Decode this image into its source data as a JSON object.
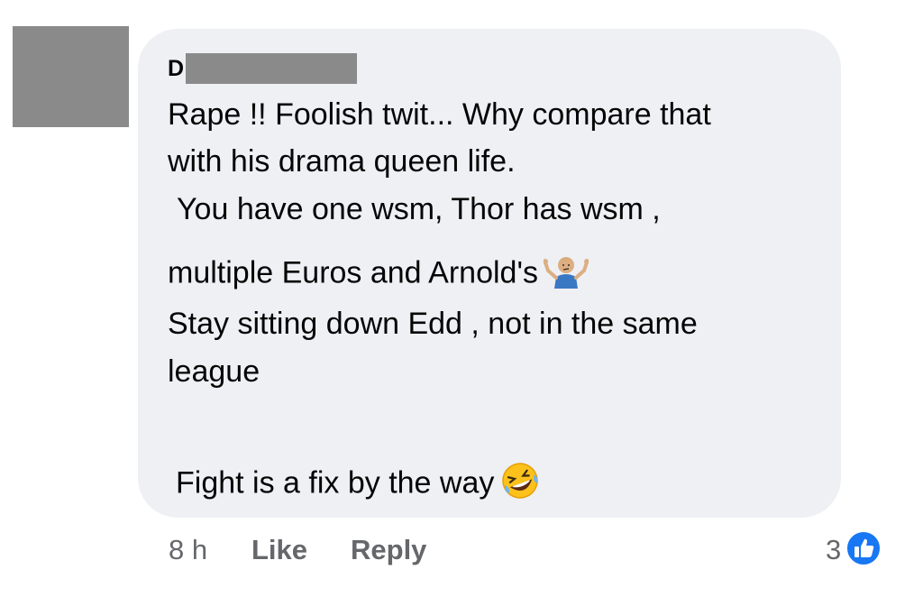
{
  "comment": {
    "author_initial": "D",
    "lines": [
      "Rape !! Foolish twit... Why compare that",
      "with his drama queen life.",
      " You have one wsm, Thor has wsm ,",
      "multiple Euros and Arnold's",
      "Stay sitting down Edd , not in the same",
      "league",
      "Fight is a fix  by the way"
    ],
    "emojis": [
      "person-shrugging-emoji",
      "rolling-on-floor-laughing-emoji"
    ]
  },
  "footer": {
    "time": "8 h",
    "like_label": "Like",
    "reply_label": "Reply",
    "reaction_count": "3",
    "reaction_icon": "thumbs-up-icon",
    "reaction_color": "#1877f2"
  }
}
